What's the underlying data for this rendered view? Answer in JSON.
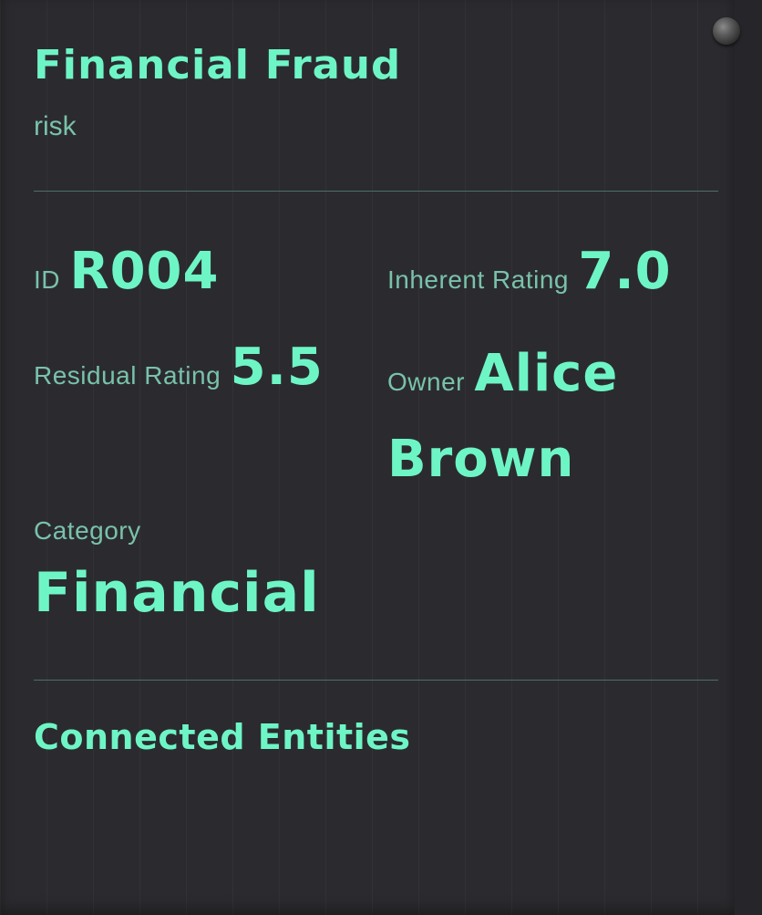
{
  "header": {
    "title": "Financial Fraud",
    "type": "risk"
  },
  "fields": {
    "id": {
      "label": "ID",
      "value": "R004"
    },
    "inherent_rating": {
      "label": "Inherent Rating",
      "value": "7.0"
    },
    "residual_rating": {
      "label": "Residual Rating",
      "value": "5.5"
    },
    "owner": {
      "label": "Owner",
      "value": "Alice Brown"
    },
    "category": {
      "label": "Category",
      "value": "Financial"
    }
  },
  "connected_entities": {
    "title": "Connected Entities",
    "items": []
  },
  "colors": {
    "accent": "#6ef5c6",
    "label": "#79c2aa",
    "background": "#2b2b2f",
    "divider": "#4d6f66"
  },
  "icons": {
    "scroll_knob": "scroll-knob-icon"
  }
}
